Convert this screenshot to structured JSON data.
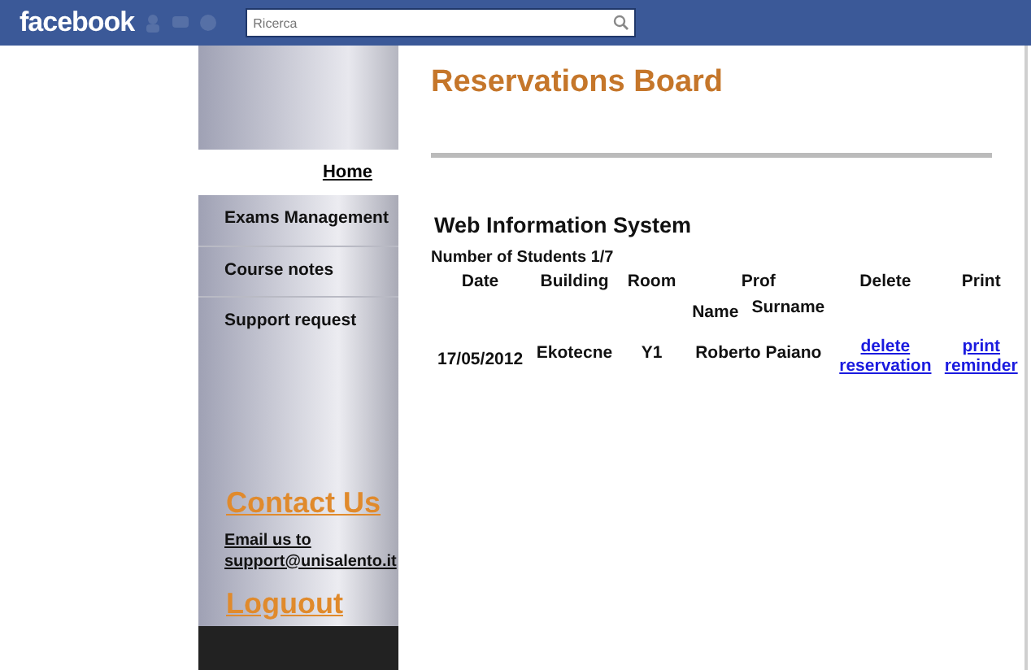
{
  "topbar": {
    "logo": "facebook",
    "search": {
      "placeholder": "Ricerca"
    }
  },
  "sidebar": {
    "home": "Home",
    "items": [
      {
        "label": "Exams Management"
      },
      {
        "label": "Course notes"
      },
      {
        "label": "Support request"
      }
    ],
    "contact_title": "Contact Us",
    "email_link": "Email us to support@unisalento.it",
    "logout": "Loguout"
  },
  "main": {
    "title": "Reservations Board",
    "subtitle": "Web Information System",
    "students": "Number of Students 1/7",
    "table": {
      "columns": [
        "Date",
        "Building",
        "Room",
        "Prof",
        "Delete",
        "Print"
      ],
      "subcolumns": [
        "Name",
        "Surname"
      ],
      "rows": [
        {
          "date": "17/05/2012",
          "building": "Ekotecne",
          "room": "Y1",
          "prof": "Roberto Paiano",
          "delete": "delete reservation",
          "print": "print reminder"
        }
      ]
    }
  }
}
